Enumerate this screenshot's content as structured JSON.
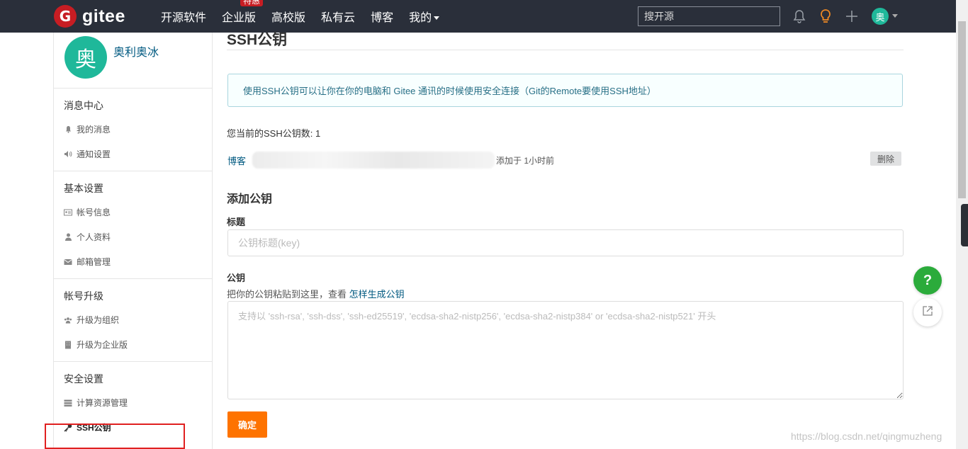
{
  "header": {
    "logo_letter": "G",
    "logo_text": "gitee",
    "nav": [
      {
        "label": "开源软件"
      },
      {
        "label": "企业版",
        "badge": "特惠"
      },
      {
        "label": "高校版"
      },
      {
        "label": "私有云"
      },
      {
        "label": "博客"
      },
      {
        "label": "我的"
      }
    ],
    "search_placeholder": "搜开源",
    "avatar_char": "奥"
  },
  "sidebar": {
    "avatar_char": "奥",
    "username": "奥利奥冰",
    "groups": [
      {
        "title": "消息中心",
        "items": [
          {
            "label": "我的消息",
            "icon": "bell-icon"
          },
          {
            "label": "通知设置",
            "icon": "speaker-icon"
          }
        ]
      },
      {
        "title": "基本设置",
        "items": [
          {
            "label": "帐号信息",
            "icon": "id-card-icon"
          },
          {
            "label": "个人资料",
            "icon": "user-icon"
          },
          {
            "label": "邮箱管理",
            "icon": "mail-icon"
          }
        ]
      },
      {
        "title": "帐号升级",
        "items": [
          {
            "label": "升级为组织",
            "icon": "group-icon"
          },
          {
            "label": "升级为企业版",
            "icon": "building-icon"
          }
        ]
      },
      {
        "title": "安全设置",
        "items": [
          {
            "label": "计算资源管理",
            "icon": "server-icon"
          },
          {
            "label": "SSH公钥",
            "icon": "key-icon"
          }
        ]
      }
    ]
  },
  "main": {
    "title": "SSH公钥",
    "info": "使用SSH公钥可以让你在你的电脑和 Gitee 通讯的时候使用安全连接（Git的Remote要使用SSH地址）",
    "count_label": "您当前的SSH公钥数: 1",
    "key": {
      "name": "博客",
      "added": "添加于 1小时前",
      "delete_label": "删除"
    },
    "add_title": "添加公钥",
    "title_label": "标题",
    "title_placeholder": "公钥标题(key)",
    "key_label": "公钥",
    "hint_text": "把你的公钥粘贴到这里，查看 ",
    "hint_link": "怎样生成公钥",
    "key_placeholder": "支持以 'ssh-rsa', 'ssh-dss', 'ssh-ed25519', 'ecdsa-sha2-nistp256', 'ecdsa-sha2-nistp384' or 'ecdsa-sha2-nistp521' 开头",
    "confirm_label": "确定"
  },
  "floating": {
    "help": "?"
  },
  "watermark": "https://blog.csdn.net/qingmuzheng",
  "colors": {
    "header_bg": "#2a2f3a",
    "brand_red": "#c71d23",
    "avatar": "#1fb89a",
    "link": "#005980",
    "confirm": "#fe7300",
    "help": "#2bab3b"
  }
}
